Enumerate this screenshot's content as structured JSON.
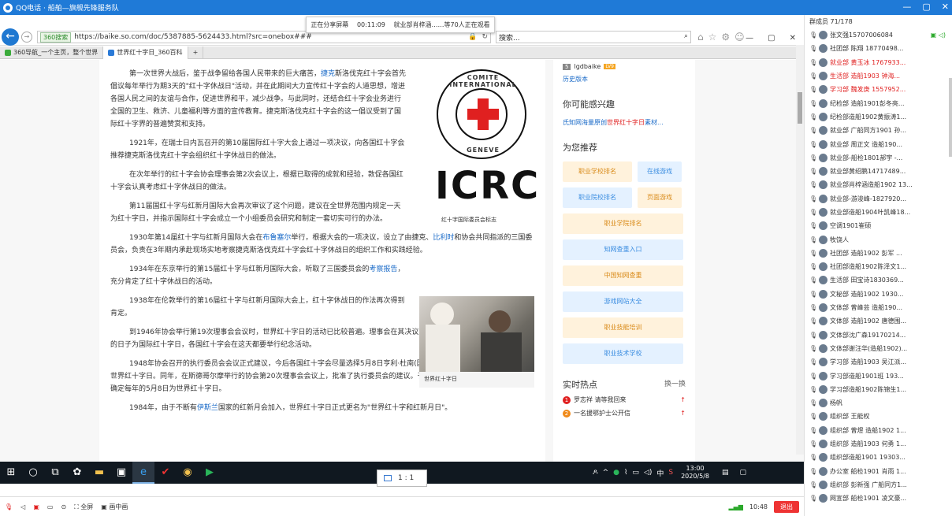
{
  "qq": {
    "title": "QQ电话 · 船舶—旗舰先锋服务队",
    "min": "—",
    "restore": "▢",
    "close": "✕"
  },
  "browser": {
    "engine": "360搜索",
    "url": "https://baike.so.com/doc/5387885-5624433.html?src=onebox###",
    "search_placeholder": "搜索...",
    "tabs": [
      {
        "label": "360导航_一个主页，整个世界"
      },
      {
        "label": "世界红十字日_360百科"
      }
    ],
    "win_min": "—",
    "win_restore": "▢",
    "win_close": "✕"
  },
  "share_bar": {
    "status": "正在分享屏幕",
    "time": "00:11:09",
    "viewers": "就业部肖梓涵……等70人正在观看"
  },
  "article": {
    "p1": "第一次世界大战后，鉴于战争留给各国人民带来的巨大痛苦，",
    "p1_link": "捷克",
    "p1b": "斯洛伐克红十字会首先倡议每年举行为期3天的\"红十字休战日\"活动，并在此期间大力宣传红十字会的人道思想，增进各国人民之间的友谊与合作，促进世界和平，减少战争。与此同时，还结合红十字会业务进行全国的卫生、救济、儿童福利等方面的宣传教育。捷克斯洛伐克红十字会的这一倡议受到了国际红十字界的普遍赞赏和支持。",
    "p2": "1921年，在瑞士日内瓦召开的第10届国际红十字大会上通过一项决议，向各国红十字会推荐捷克斯洛伐克红十字会组织红十字休战日的做法。",
    "p3": "在次年举行的红十字会协会理事会第2次会议上，根据已取得的成就和经验，敦促各国红十字会认真考虑红十字休战日的做法。",
    "p4": "第11届国红十字与红新月国际大会再次审议了这个问题，建议在全世界范围内规定一天为红十字日，并指示国际红十字会成立一个小组委员会研究和制定一套切实可行的办法。",
    "p5a": "1930年第14届红十字与红新月国际大会在",
    "p5_link1": "布鲁塞尔",
    "p5b": "举行，根据大会的一项决议，设立了由捷克、",
    "p5_link2": "比利时",
    "p5c": "和协会共同指派的三国委员会，负责在3年期内承赴现场实地考察捷克斯洛伐克红十字会红十字休战日的组织工作和实践经验。",
    "p6a": "1934年在东京举行的第15届红十字与红新月国际大会，听取了三国委员会的",
    "p6_link": "考察报告",
    "p6b": "，充分肯定了红十字休战日的活动。",
    "p7": "1938年在伦敦举行的第16届红十字与红新月国际大会上，红十字休战日的作法再次得到肯定。",
    "p8": "到1946年协会举行第19次理事会会议时，世界红十字日的活动已比较普遍。理事会在其决议中指示协会秘书处研究确定一个固定的日子为国际红十字日，各国红十字会在这天都要举行纪念活动。",
    "p9": "1948年协会召开的执行委员会会议正式建议，今后各国红十字会尽量选择5月8日亨利·杜南(国际红十字组织的创建人)的生日作为世界红十字日。同年，在斯德哥尔摩举行的协会第20次理事会会议上，批准了执行委员会的建议。于是，红十字与红新月国际大会正式确定每年的5月8日为世界红十字日。",
    "p10a": "1984年，由于不断有",
    "p10_link": "伊斯兰",
    "p10b": "国家的红新月会加入，世界红十字日正式更名为\"世界红十字和红新月日\"。"
  },
  "icrc": {
    "top": "COMITE INTERNATIONAL",
    "bottom": "GENEVE",
    "wordmark": "ICRC",
    "caption": "红十字国际委员会标志"
  },
  "photo": {
    "caption": "世界红十字日"
  },
  "sidebar": {
    "author_num": "5",
    "author": "lgdbaike",
    "level": "LV9",
    "history": "历史版本",
    "interest_title": "你可能感兴趣",
    "interest_a": "氏知网海量原创",
    "interest_b": "世界红十字日",
    "interest_c": "素材...",
    "rec_title": "为您推荐",
    "recs": [
      "职业学校排名",
      "在线游戏",
      "职业院校排名",
      "页面游戏",
      "职业学院排名",
      "知网查重入口",
      "中国知网查重",
      "游戏网站大全",
      "职业技能培训",
      "职业技术学校"
    ],
    "hot_title": "实时热点",
    "hot_switch": "换一换",
    "hot": [
      {
        "rank": "1",
        "text": "罗志祥 请等我回来"
      },
      {
        "rank": "2",
        "text": "一名援鄂护士公开信"
      }
    ]
  },
  "zoom": {
    "value": "1 : 1"
  },
  "clock": {
    "time": "13:00",
    "date": "2020/5/8"
  },
  "tray": {
    "ime": "中",
    "notif": "⌨"
  },
  "qq_bottom": {
    "full": "全屏",
    "pip": "画中画",
    "duration": "10:48",
    "exit": "退出"
  },
  "members": {
    "header": "群成员 71/178",
    "list": [
      {
        "name": "张文强15707006084",
        "red": false
      },
      {
        "name": "社团部 陈翔 18770498...",
        "red": false
      },
      {
        "name": "就业部 黄玉冰 1767933...",
        "red": true
      },
      {
        "name": "生活部 造船1903 钟海...",
        "red": true
      },
      {
        "name": "学习部 魏发庚 1557952...",
        "red": true
      },
      {
        "name": "纪检部 造船1901彭冬亮...",
        "red": false
      },
      {
        "name": "纪检部造船1902黄振涛1...",
        "red": false
      },
      {
        "name": "就业部 广船同方1901 孙...",
        "red": false
      },
      {
        "name": "就业部 周正文 造船190...",
        "red": false
      },
      {
        "name": "就业部-船检1801郝宇 -...",
        "red": false
      },
      {
        "name": "就业部黄绍鹏14717489...",
        "red": false
      },
      {
        "name": "就业部肖梓涵造船1902 13...",
        "red": false
      },
      {
        "name": "就业部-游浚峰-1827920...",
        "red": false
      },
      {
        "name": "就业部造船1904叶凯峰18...",
        "red": false
      },
      {
        "name": "空调1901崔硕",
        "red": false
      },
      {
        "name": "牧饶人",
        "red": false
      },
      {
        "name": "社团部 造船1902 彭军 ...",
        "red": false
      },
      {
        "name": "社团部造船1902陈泽文1...",
        "red": false
      },
      {
        "name": "生活部 田宝诗1830369...",
        "red": false
      },
      {
        "name": "文秘部 造船1902 1930...",
        "red": false
      },
      {
        "name": "文体部 曾峰芸 造船190...",
        "red": false
      },
      {
        "name": "文体部 造船1902 唐德围...",
        "red": false
      },
      {
        "name": "文体部沈广森19170214...",
        "red": false
      },
      {
        "name": "文体部谢汪华(造船1902)...",
        "red": false
      },
      {
        "name": "学习部 造船1903 吴江派...",
        "red": false
      },
      {
        "name": "学习部造船1901班 193...",
        "red": false
      },
      {
        "name": "学习部造船1902陈锦生1...",
        "red": false
      },
      {
        "name": "杨帆",
        "red": false
      },
      {
        "name": "组织部 王能权",
        "red": false
      },
      {
        "name": "组织部 曾煜 造船1902 1...",
        "red": false
      },
      {
        "name": "组织部 造船1903 何勇 1...",
        "red": false
      },
      {
        "name": "组织部造船1901 19303...",
        "red": false
      },
      {
        "name": "办公室 船检1901 肖雨 1...",
        "red": false
      },
      {
        "name": "组织部 彭新强 广船同方1...",
        "red": false
      },
      {
        "name": "网宣部 船检1901 凌文豪...",
        "red": false
      }
    ]
  }
}
